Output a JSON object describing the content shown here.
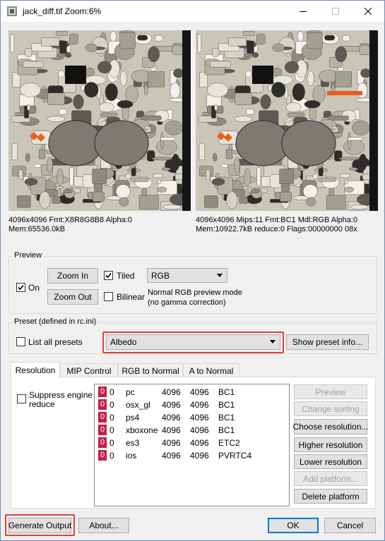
{
  "window": {
    "title": "jack_diff.tif  Zoom:6%"
  },
  "colors": {
    "accent": "#0078d7",
    "highlight": "#e0403a",
    "badge": "#c21f4b"
  },
  "source_info": {
    "line1": "4096x4096 Fmt:X8R8G8B8 Alpha:0",
    "line2": "Mem:65536.0kB"
  },
  "output_info": {
    "line1": "4096x4096 Mips:11 Fmt:BC1 Mdl:RGB Alpha:0",
    "line2": "Mem:10922.7kB reduce:0 Flags:00000000  08x"
  },
  "preview": {
    "group_label": "Preview",
    "on_label": "On",
    "on_checked": true,
    "zoom_in": "Zoom In",
    "zoom_out": "Zoom Out",
    "tiled_label": "Tiled",
    "tiled_checked": true,
    "bilinear_label": "Bilinear",
    "bilinear_checked": false,
    "mode_value": "RGB",
    "mode_desc_line1": "Normal RGB preview mode",
    "mode_desc_line2": "(no gamma correction)"
  },
  "preset": {
    "group_label": "Preset (defined in rc.ini)",
    "list_all_label": "List all presets",
    "list_all_checked": false,
    "value": "Albedo",
    "info_button": "Show preset info..."
  },
  "tabs": [
    "Resolution",
    "MIP Control",
    "RGB to Normal",
    "A to Normal"
  ],
  "resolution": {
    "suppress_label_line1": "Suppress engine",
    "suppress_label_line2": "reduce",
    "suppress_checked": false,
    "platforms": [
      {
        "badge": "0",
        "reduce": "0",
        "name": "pc",
        "width": "4096",
        "height": "4096",
        "format": "BC1"
      },
      {
        "badge": "0",
        "reduce": "0",
        "name": "osx_gl",
        "width": "4096",
        "height": "4096",
        "format": "BC1"
      },
      {
        "badge": "0",
        "reduce": "0",
        "name": "ps4",
        "width": "4096",
        "height": "4096",
        "format": "BC1"
      },
      {
        "badge": "0",
        "reduce": "0",
        "name": "xboxone",
        "width": "4096",
        "height": "4096",
        "format": "BC1"
      },
      {
        "badge": "0",
        "reduce": "0",
        "name": "es3",
        "width": "4096",
        "height": "4096",
        "format": "ETC2"
      },
      {
        "badge": "0",
        "reduce": "0",
        "name": "ios",
        "width": "4096",
        "height": "4096",
        "format": "PVRTC4"
      }
    ],
    "buttons": {
      "preview": "Preview",
      "change_sorting": "Change sorting",
      "choose_resolution": "Choose resolution...",
      "higher_resolution": "Higher resolution",
      "lower_resolution": "Lower resolution",
      "add_platform": "Add platform...",
      "delete_platform": "Delete platform"
    }
  },
  "footer": {
    "generate": "Generate Output",
    "about": "About...",
    "ok": "OK",
    "cancel": "Cancel"
  }
}
